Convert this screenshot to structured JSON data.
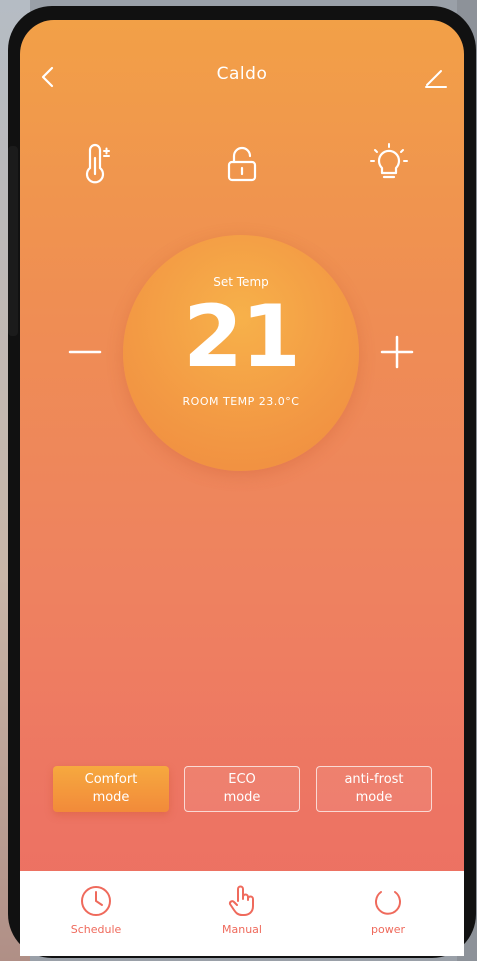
{
  "header": {
    "title": "Caldo"
  },
  "controls": {
    "set_label": "Set Temp",
    "temperature": "21",
    "sub_text": "ROOM TEMP 23.0°C"
  },
  "modes": [
    {
      "label_line1": "Comfort",
      "label_line2": "mode",
      "active": true
    },
    {
      "label_line1": "ECO",
      "label_line2": "mode",
      "active": false
    },
    {
      "label_line1": "anti-frost",
      "label_line2": "mode",
      "active": false
    }
  ],
  "tabs": [
    {
      "label": "Schedule",
      "icon": "clock-icon"
    },
    {
      "label": "Manual",
      "icon": "hand-pointer-icon"
    },
    {
      "label": "power",
      "icon": "power-icon"
    }
  ],
  "colors": {
    "gradient_top": "#f2a047",
    "gradient_bottom": "#ec6f62",
    "dial": "#f39a44",
    "tab_accent": "#ef6a5c"
  }
}
